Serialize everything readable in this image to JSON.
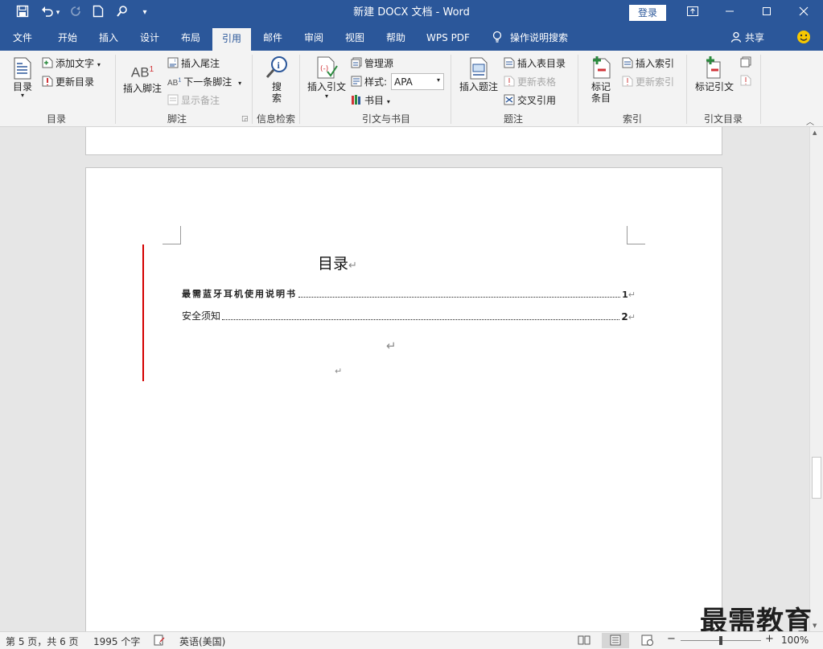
{
  "titlebar": {
    "title": "新建 DOCX 文档  -  Word",
    "login": "登录",
    "icons": [
      "save-icon",
      "undo-icon",
      "redo-icon",
      "new-doc-icon",
      "touch-mode-icon",
      "customize-icon"
    ]
  },
  "menu": {
    "tabs": [
      "文件",
      "开始",
      "插入",
      "设计",
      "布局",
      "引用",
      "邮件",
      "审阅",
      "视图",
      "帮助",
      "WPS PDF"
    ],
    "active_tab": "引用",
    "tell_me": "操作说明搜索",
    "share": "共享"
  },
  "ribbon": {
    "toc_group": {
      "toc": "目录",
      "add_text": "添加文字",
      "update_toc": "更新目录",
      "label": "目录"
    },
    "footnote_group": {
      "insert_footnote": "插入脚注",
      "insert_endnote": "插入尾注",
      "next_footnote": "下一条脚注",
      "show_notes": "显示备注",
      "label": "脚注"
    },
    "research_group": {
      "search_line1": "搜",
      "search_line2": "索",
      "label": "信息检索"
    },
    "citation_group": {
      "insert_citation": "插入引文",
      "manage_sources": "管理源",
      "style_label": "样式:",
      "style_value": "APA",
      "bibliography": "书目",
      "label": "引文与书目"
    },
    "caption_group": {
      "insert_caption": "插入题注",
      "insert_table_of_figures": "插入表目录",
      "update_table": "更新表格",
      "cross_reference": "交叉引用",
      "label": "题注"
    },
    "index_group": {
      "mark_entry_line1": "标记",
      "mark_entry_line2": "条目",
      "insert_index": "插入索引",
      "update_index": "更新索引",
      "label": "索引"
    },
    "toa_group": {
      "mark_citation": "标记引文",
      "label": "引文目录"
    }
  },
  "document": {
    "toc_title": "目录",
    "entries": [
      {
        "text": "最需蓝牙耳机使用说明书",
        "page": "1"
      },
      {
        "text": "安全须知",
        "page": "2"
      }
    ],
    "para_mark": "↵"
  },
  "statusbar": {
    "page_info": "第 5 页，共 6 页",
    "word_count": "1995 个字",
    "language": "英语(美国)",
    "zoom": "100%",
    "zoom_percent": 100
  },
  "watermark": "最需教育",
  "colors": {
    "accent": "#2b579a",
    "change_bar": "#d40000"
  }
}
